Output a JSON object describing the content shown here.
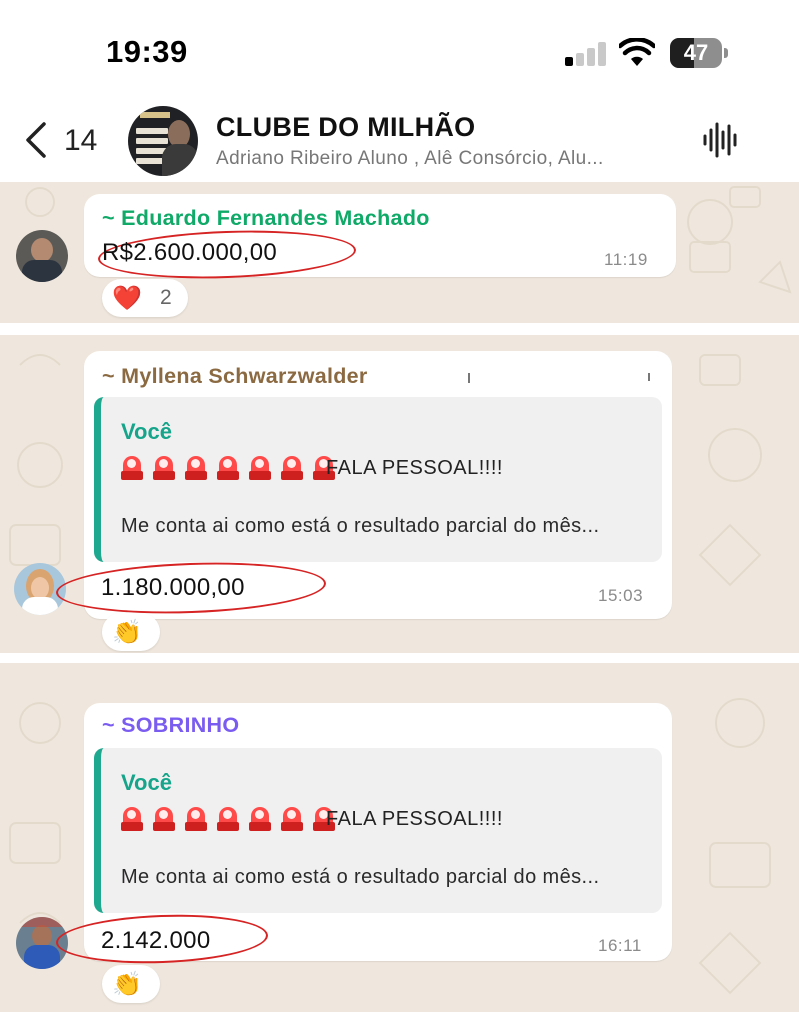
{
  "status_bar": {
    "time": "19:39",
    "battery": "47",
    "battery_level": 0.47
  },
  "header": {
    "back_count": "14",
    "title": "CLUBE DO MILHÃO",
    "subtitle": "Adriano Ribeiro Aluno , Alê Consórcio, Alu..."
  },
  "messages": [
    {
      "sender": "~ Eduardo Fernandes Machado",
      "sender_color": "#0fa968",
      "text": "R$2.600.000,00",
      "time": "11:19",
      "reaction": {
        "emoji": "❤️",
        "count": "2"
      }
    },
    {
      "sender": "~ Myllena Schwarzwalder",
      "sender_color": "#8b6a42",
      "quote": {
        "author": "Você",
        "headline": "FALA PESSOAL!!!!",
        "body": "Me conta ai como está o resultado parcial do mês..."
      },
      "text": "1.180.000,00",
      "time": "15:03",
      "reaction": {
        "emoji": "👏"
      }
    },
    {
      "sender": "~ SOBRINHO",
      "sender_color": "#7b5cf0",
      "quote": {
        "author": "Você",
        "headline": "FALA PESSOAL!!!!",
        "body": "Me conta ai como está o resultado parcial do mês..."
      },
      "text": "2.142.000",
      "time": "16:11",
      "reaction": {
        "emoji": "👏"
      }
    }
  ],
  "icons": {
    "back": "chevron-left-icon",
    "audio": "waveform-icon",
    "signal": "cellular-signal-icon",
    "wifi": "wifi-icon",
    "battery": "battery-icon",
    "siren": "police-light-icon"
  },
  "colors": {
    "highlight_circle": "#d62323",
    "quote_bar": "#1ea890",
    "chat_background": "#efe7dd"
  }
}
